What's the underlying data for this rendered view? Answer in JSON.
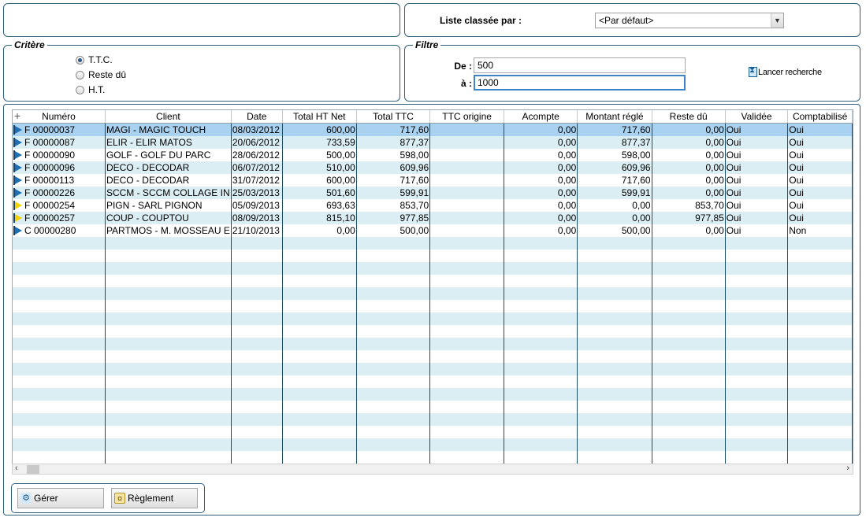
{
  "sort": {
    "label": "Liste classée par :",
    "selected": "<Par défaut>"
  },
  "critere": {
    "title": "Critère",
    "options": [
      {
        "label": "T.T.C.",
        "checked": true
      },
      {
        "label": "Reste dû",
        "checked": false
      },
      {
        "label": "H.T.",
        "checked": false
      }
    ]
  },
  "filtre": {
    "title": "Filtre",
    "de_label": "De :",
    "de_value": "500",
    "a_label": "à :",
    "a_value": "1000",
    "search_label": "Lancer recherche"
  },
  "table": {
    "add_column_icon": "+",
    "columns": [
      "Numéro",
      "Client",
      "Date",
      "Total HT Net",
      "Total TTC",
      "TTC origine",
      "Acompte",
      "Montant réglé",
      "Reste dû",
      "Validée",
      "Comptabilisé"
    ],
    "rows": [
      {
        "flag": "blue",
        "numero": "F 00000037",
        "client": "MAGI - MAGIC TOUCH",
        "date": "08/03/2012",
        "ht": "600,00",
        "ttc": "717,60",
        "ttc_origine": "",
        "acompte": "0,00",
        "regle": "717,60",
        "reste": "0,00",
        "validee": "Oui",
        "compta": "Oui",
        "selected": true
      },
      {
        "flag": "blue",
        "numero": "F 00000087",
        "client": "ELIR - ELIR MATOS",
        "date": "20/06/2012",
        "ht": "733,59",
        "ttc": "877,37",
        "ttc_origine": "",
        "acompte": "0,00",
        "regle": "877,37",
        "reste": "0,00",
        "validee": "Oui",
        "compta": "Oui"
      },
      {
        "flag": "blue",
        "numero": "F 00000090",
        "client": "GOLF - GOLF DU PARC",
        "date": "28/06/2012",
        "ht": "500,00",
        "ttc": "598,00",
        "ttc_origine": "",
        "acompte": "0,00",
        "regle": "598,00",
        "reste": "0,00",
        "validee": "Oui",
        "compta": "Oui"
      },
      {
        "flag": "blue",
        "numero": "F 00000096",
        "client": "DECO - DECODAR",
        "date": "06/07/2012",
        "ht": "510,00",
        "ttc": "609,96",
        "ttc_origine": "",
        "acompte": "0,00",
        "regle": "609,96",
        "reste": "0,00",
        "validee": "Oui",
        "compta": "Oui"
      },
      {
        "flag": "blue",
        "numero": "F 00000113",
        "client": "DECO - DECODAR",
        "date": "31/07/2012",
        "ht": "600,00",
        "ttc": "717,60",
        "ttc_origine": "",
        "acompte": "0,00",
        "regle": "717,60",
        "reste": "0,00",
        "validee": "Oui",
        "compta": "Oui"
      },
      {
        "flag": "blue",
        "numero": "F 00000226",
        "client": "SCCM - SCCM COLLAGE IN",
        "date": "25/03/2013",
        "ht": "501,60",
        "ttc": "599,91",
        "ttc_origine": "",
        "acompte": "0,00",
        "regle": "599,91",
        "reste": "0,00",
        "validee": "Oui",
        "compta": "Oui"
      },
      {
        "flag": "yellow",
        "numero": "F 00000254",
        "client": "PIGN - SARL PIGNON",
        "date": "05/09/2013",
        "ht": "693,63",
        "ttc": "853,70",
        "ttc_origine": "",
        "acompte": "0,00",
        "regle": "0,00",
        "reste": "853,70",
        "validee": "Oui",
        "compta": "Oui"
      },
      {
        "flag": "yellow",
        "numero": "F 00000257",
        "client": "COUP - COUPTOU",
        "date": "08/09/2013",
        "ht": "815,10",
        "ttc": "977,85",
        "ttc_origine": "",
        "acompte": "0,00",
        "regle": "0,00",
        "reste": "977,85",
        "validee": "Oui",
        "compta": "Oui"
      },
      {
        "flag": "blue",
        "numero": "C 00000280",
        "client": "PARTMOS - M. MOSSEAU E",
        "date": "21/10/2013",
        "ht": "0,00",
        "ttc": "500,00",
        "ttc_origine": "",
        "acompte": "0,00",
        "regle": "500,00",
        "reste": "0,00",
        "validee": "Oui",
        "compta": "Non"
      }
    ]
  },
  "buttons": {
    "gerer": "Gérer",
    "reglement": "Règlement"
  }
}
